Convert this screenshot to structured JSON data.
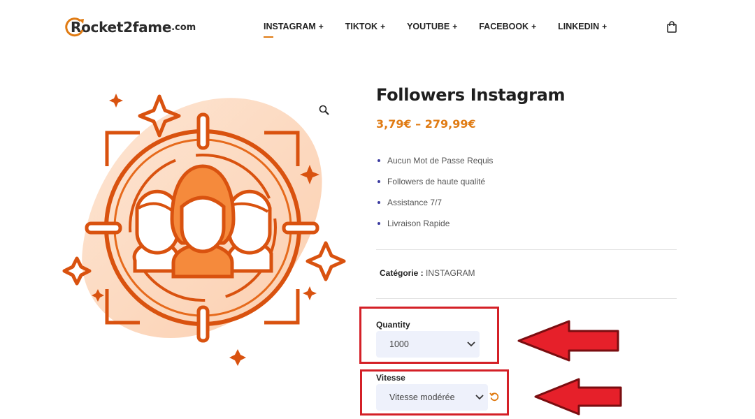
{
  "header": {
    "logo_text": "Rocket2fame",
    "logo_suffix": ".com",
    "nav": [
      {
        "label": "INSTAGRAM",
        "active": true
      },
      {
        "label": "TIKTOK",
        "active": false
      },
      {
        "label": "YOUTUBE",
        "active": false
      },
      {
        "label": "FACEBOOK",
        "active": false
      },
      {
        "label": "LINKEDIN",
        "active": false
      }
    ],
    "nav_plus": "+",
    "cart_icon": "shopping-bag-icon"
  },
  "product": {
    "title": "Followers Instagram",
    "price_range": "3,79€ – 279,99€",
    "features": [
      "Aucun Mot de Passe Requis",
      "Followers de haute qualité",
      "Assistance 7/7",
      "Livraison Rapide"
    ],
    "category_label": "Catégorie :",
    "category_value": "INSTAGRAM",
    "quantity": {
      "label": "Quantity",
      "selected": "1000"
    },
    "speed": {
      "label": "Vitesse",
      "selected": "Vitesse modérée"
    }
  },
  "colors": {
    "accent": "#e07b13",
    "annotation": "#d42027",
    "select_bg": "#eef1fb"
  }
}
